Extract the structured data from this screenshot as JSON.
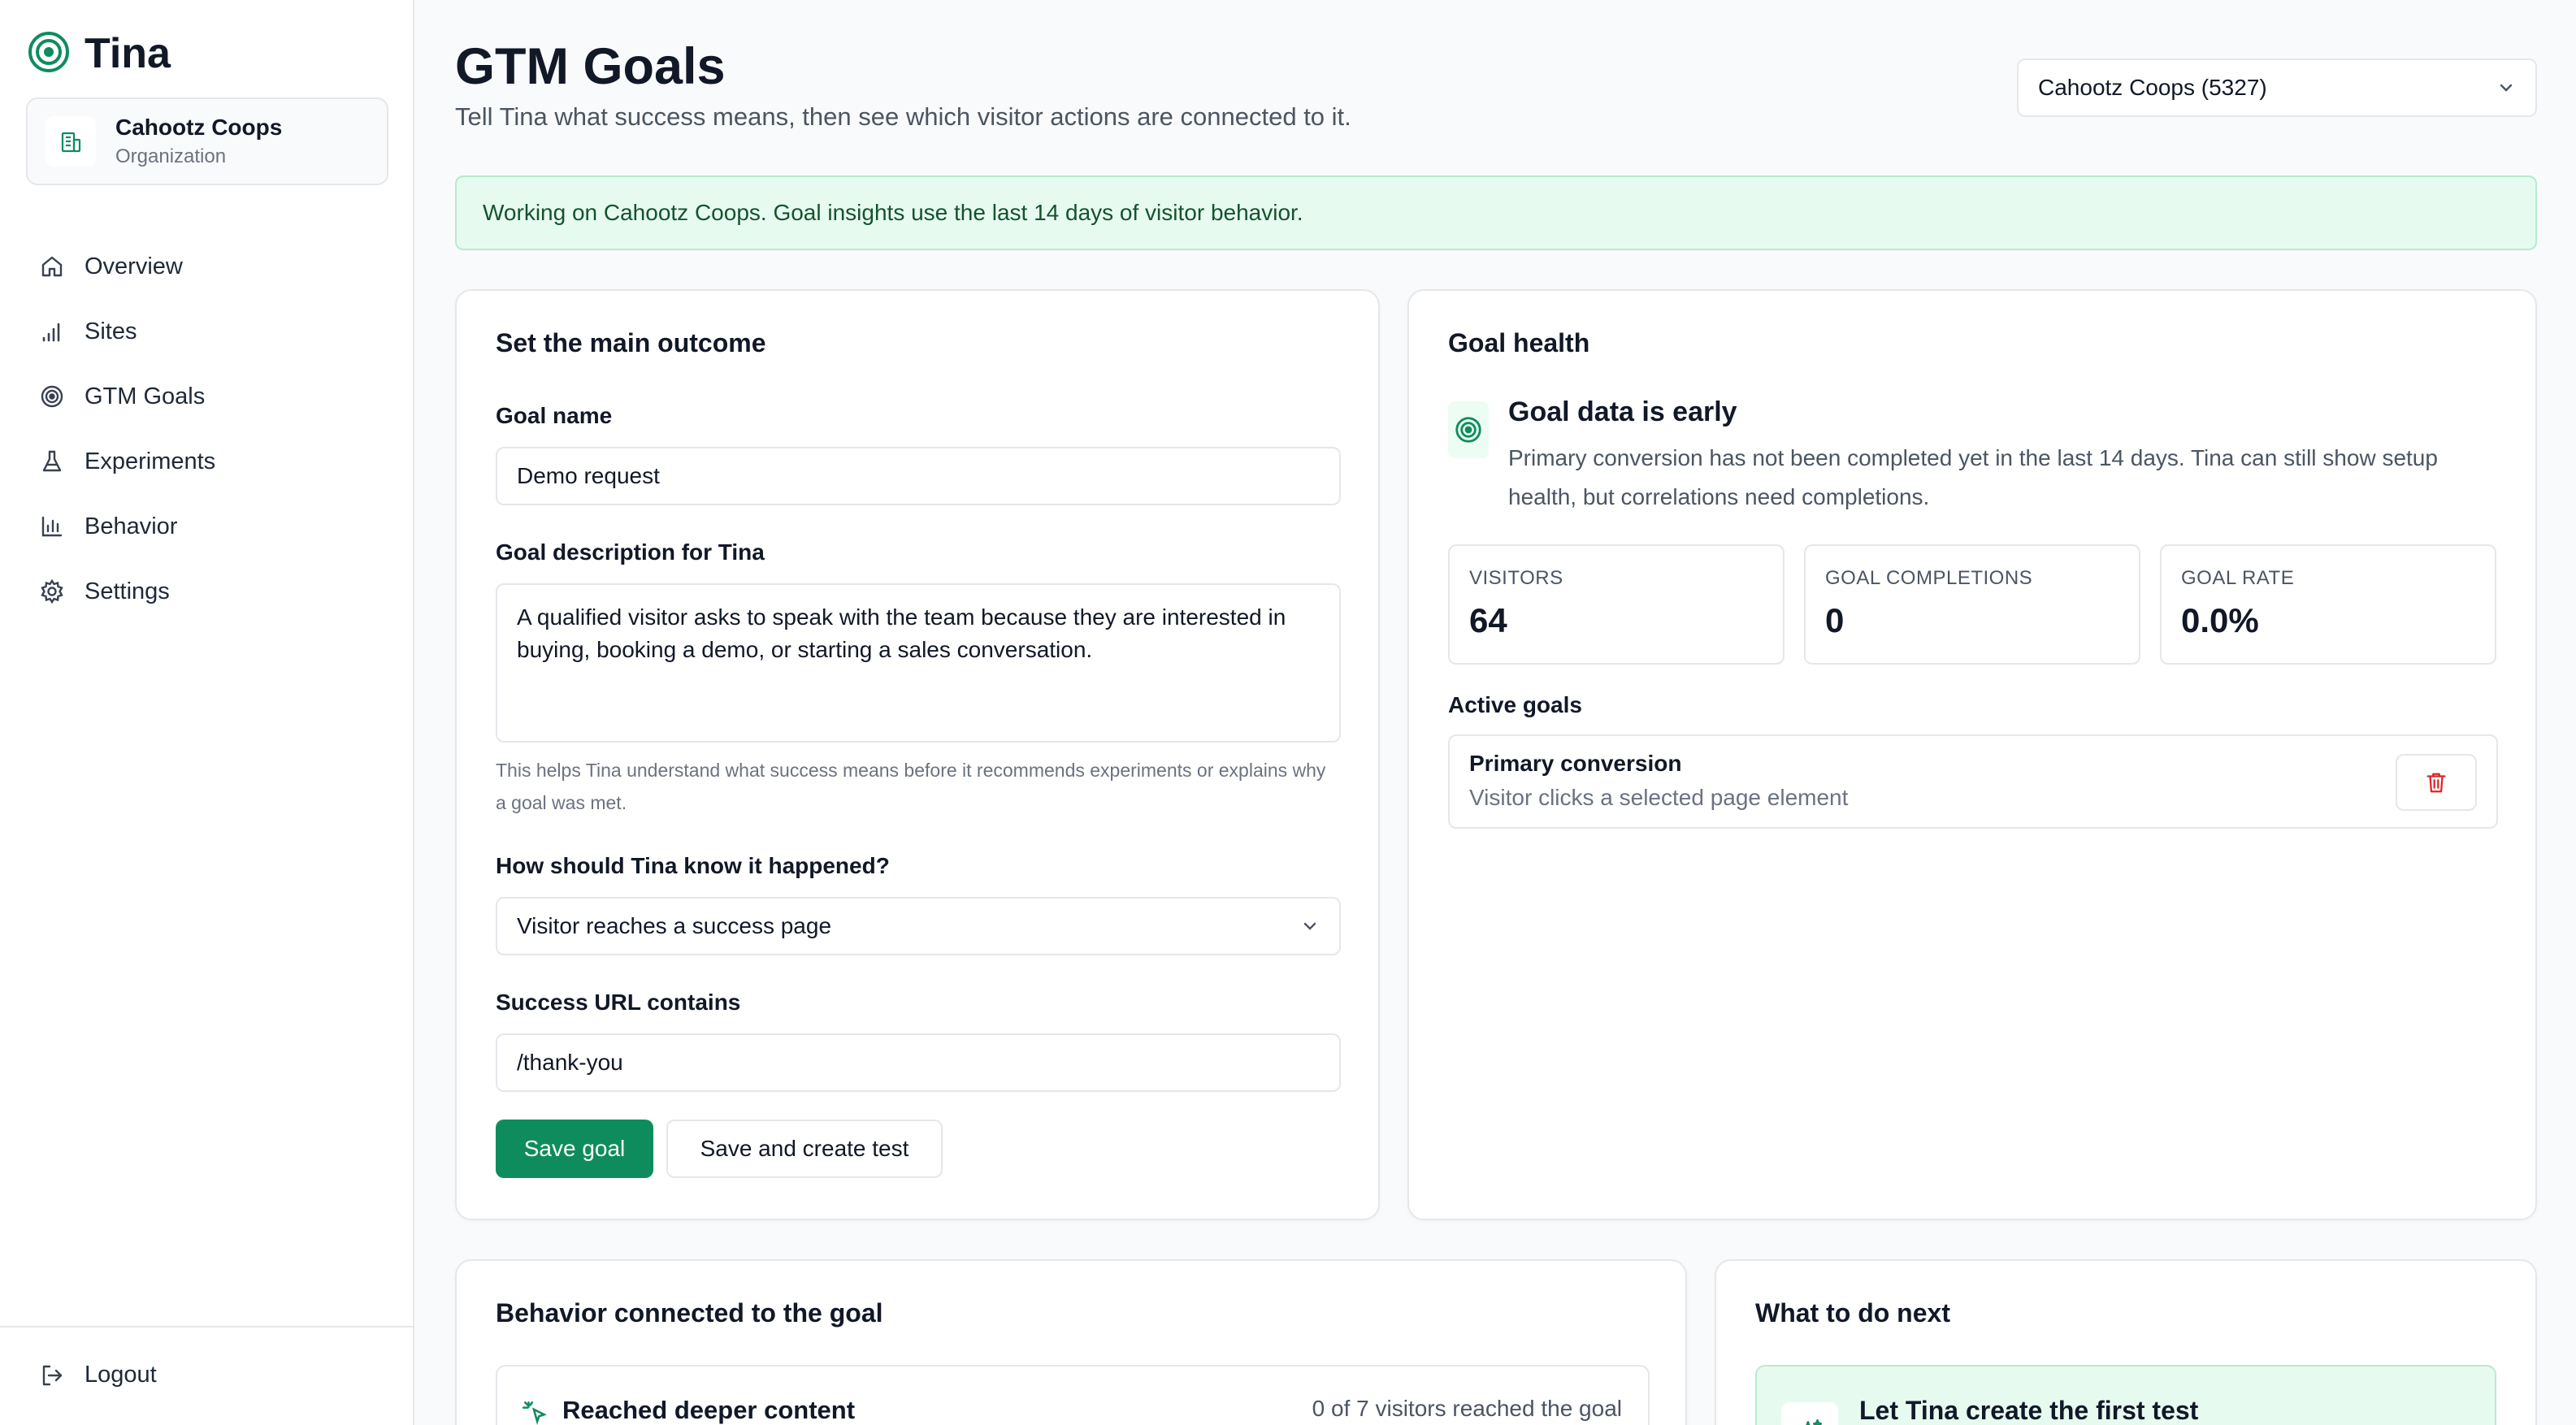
{
  "app": {
    "name": "Tina"
  },
  "org_card": {
    "name": "Cahootz Coops",
    "sub": "Organization"
  },
  "nav": [
    {
      "label": "Overview",
      "icon": "home-icon"
    },
    {
      "label": "Sites",
      "icon": "signal-bars-icon"
    },
    {
      "label": "GTM Goals",
      "icon": "target-icon"
    },
    {
      "label": "Experiments",
      "icon": "flask-icon"
    },
    {
      "label": "Behavior",
      "icon": "bar-chart-icon"
    },
    {
      "label": "Settings",
      "icon": "gear-icon"
    }
  ],
  "logout": {
    "label": "Logout",
    "icon": "logout-icon"
  },
  "header": {
    "title": "GTM Goals",
    "subtitle": "Tell Tina what success means, then see which visitor actions are connected to it.",
    "org_select": "Cahootz Coops (5327)"
  },
  "notice": "Working on Cahootz Coops. Goal insights use the last 14 days of visitor behavior.",
  "outcome": {
    "title": "Set the main outcome",
    "goal_name_label": "Goal name",
    "goal_name_value": "Demo request",
    "desc_label": "Goal description for Tina",
    "desc_value": "A qualified visitor asks to speak with the team because they are interested in buying, booking a demo, or starting a sales conversation.",
    "helper": "This helps Tina understand what success means before it recommends experiments or explains why a goal was met.",
    "method_label": "How should Tina know it happened?",
    "method_value": "Visitor reaches a success page",
    "url_label": "Success URL contains",
    "url_value": "/thank-you",
    "save_label": "Save goal",
    "save_test_label": "Save and create test"
  },
  "health": {
    "title": "Goal health",
    "status_title": "Goal data is early",
    "status_desc": "Primary conversion has not been completed yet in the last 14 days. Tina can still show setup health, but correlations need completions.",
    "stats": [
      {
        "label": "VISITORS",
        "value": "64"
      },
      {
        "label": "GOAL COMPLETIONS",
        "value": "0"
      },
      {
        "label": "GOAL RATE",
        "value": "0.0%"
      }
    ],
    "active_label": "Active goals",
    "active_goal": {
      "name": "Primary conversion",
      "sub": "Visitor clicks a selected page element"
    }
  },
  "behavior": {
    "title": "Behavior connected to the goal",
    "item_name": "Reached deeper content",
    "item_stat": "0 of 7 visitors reached the goal"
  },
  "next": {
    "title": "What to do next",
    "item_title": "Let Tina create the first test"
  },
  "colors": {
    "accent": "#0f8c5e",
    "notice_bg": "#e7faf0",
    "danger": "#dc2626"
  }
}
